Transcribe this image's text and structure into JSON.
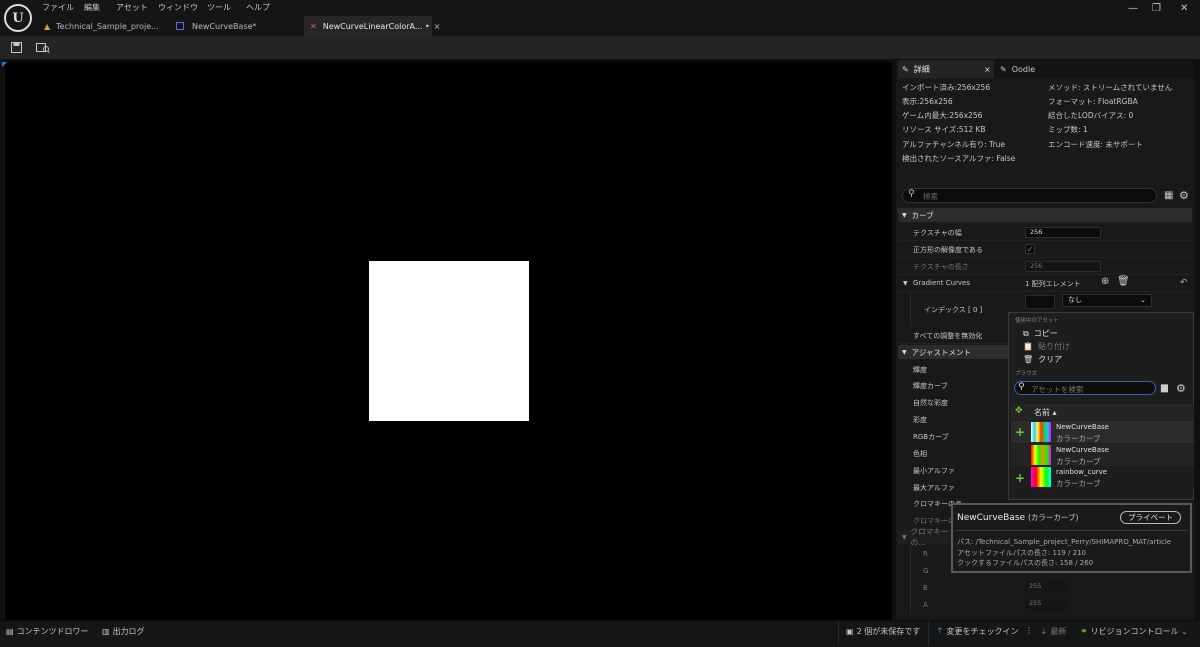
{
  "menu": [
    "ファイル",
    "編集",
    "アセット",
    "ウィンドウ",
    "ツール",
    "ヘルプ"
  ],
  "tabs": [
    {
      "label": "Technical_Sample_proje..."
    },
    {
      "label": "NewCurveBase*"
    },
    {
      "label": "NewCurveLinearColorA... •"
    }
  ],
  "details": {
    "tabs": [
      {
        "label": "詳細"
      },
      {
        "label": "Oodle"
      }
    ],
    "info_left": [
      "インポート済み:256x256",
      "表示:256x256",
      "ゲーム内最大:256x256",
      "リソース サイズ:512 KB",
      "アルファチャンネル有り: True",
      "検出されたソースアルファ: False"
    ],
    "info_right": [
      "メソッド: ストリームされていません",
      "フォーマット: FloatRGBA",
      "結合したLODバイアス: 0",
      "ミップ数: 1",
      "エンコード速度: 未サポート"
    ],
    "search_placeholder": "検索",
    "curve_header": "カーブ",
    "texture_width_label": "テクスチャの幅",
    "texture_width_value": "256",
    "square_label": "正方形の解像度である",
    "texture_height_label": "テクスチャの長さ",
    "texture_height_value": "256",
    "gradient_label": "Gradient Curves",
    "gradient_count": "1 配列エレメント",
    "index_label": "インデックス [ 0 ]",
    "none_label": "なし",
    "disable_all_label": "すべての調整を無効化",
    "adjust_header": "アジャストメント",
    "adjust_items": [
      "輝度",
      "輝度カーブ",
      "自然な彩度",
      "彩度",
      "RGBカーブ",
      "色相",
      "最小アルファ",
      "最大アルファ",
      "クロマキーのラ..."
    ],
    "chroma_dim": "クロマキーの...",
    "chroma_sub": "クロマキーの...",
    "rgba": [
      {
        "label": "R",
        "value": ""
      },
      {
        "label": "G",
        "value": ""
      },
      {
        "label": "B",
        "value": "255"
      },
      {
        "label": "A",
        "value": "255"
      }
    ]
  },
  "popup": {
    "section_current": "使用中のアセット",
    "copy": "コピー",
    "paste": "貼り付け",
    "clear": "クリア",
    "section_browse": "ブラウズ",
    "search_placeholder": "アセットを検索",
    "column_name": "名前",
    "assets": [
      {
        "name": "NewCurveBase",
        "type": "カラーカーブ"
      },
      {
        "name": "NewCurveBase",
        "type": "カラーカーブ"
      },
      {
        "name": "rainbow_curve",
        "type": "カラーカーブ"
      }
    ]
  },
  "tooltip": {
    "title": "NewCurveBase",
    "type": "(カラーカーブ)",
    "badge": "プライベート",
    "path": "パス: /Technical_Sample_project_Perry/SHIMAPRO_MAT/article",
    "asset_path_len": "アセットファイルパスの長さ: 119 / 210",
    "cook_path_len": "クックするファイルパスの長さ: 158 / 260"
  },
  "status": {
    "content_drawer": "コンテンツドロワー",
    "output_log": "出力ログ",
    "unsaved": "2 個が未保存です",
    "check_in": "変更をチェックイン",
    "latest": "最新",
    "revision": "リビジョンコントロール"
  }
}
